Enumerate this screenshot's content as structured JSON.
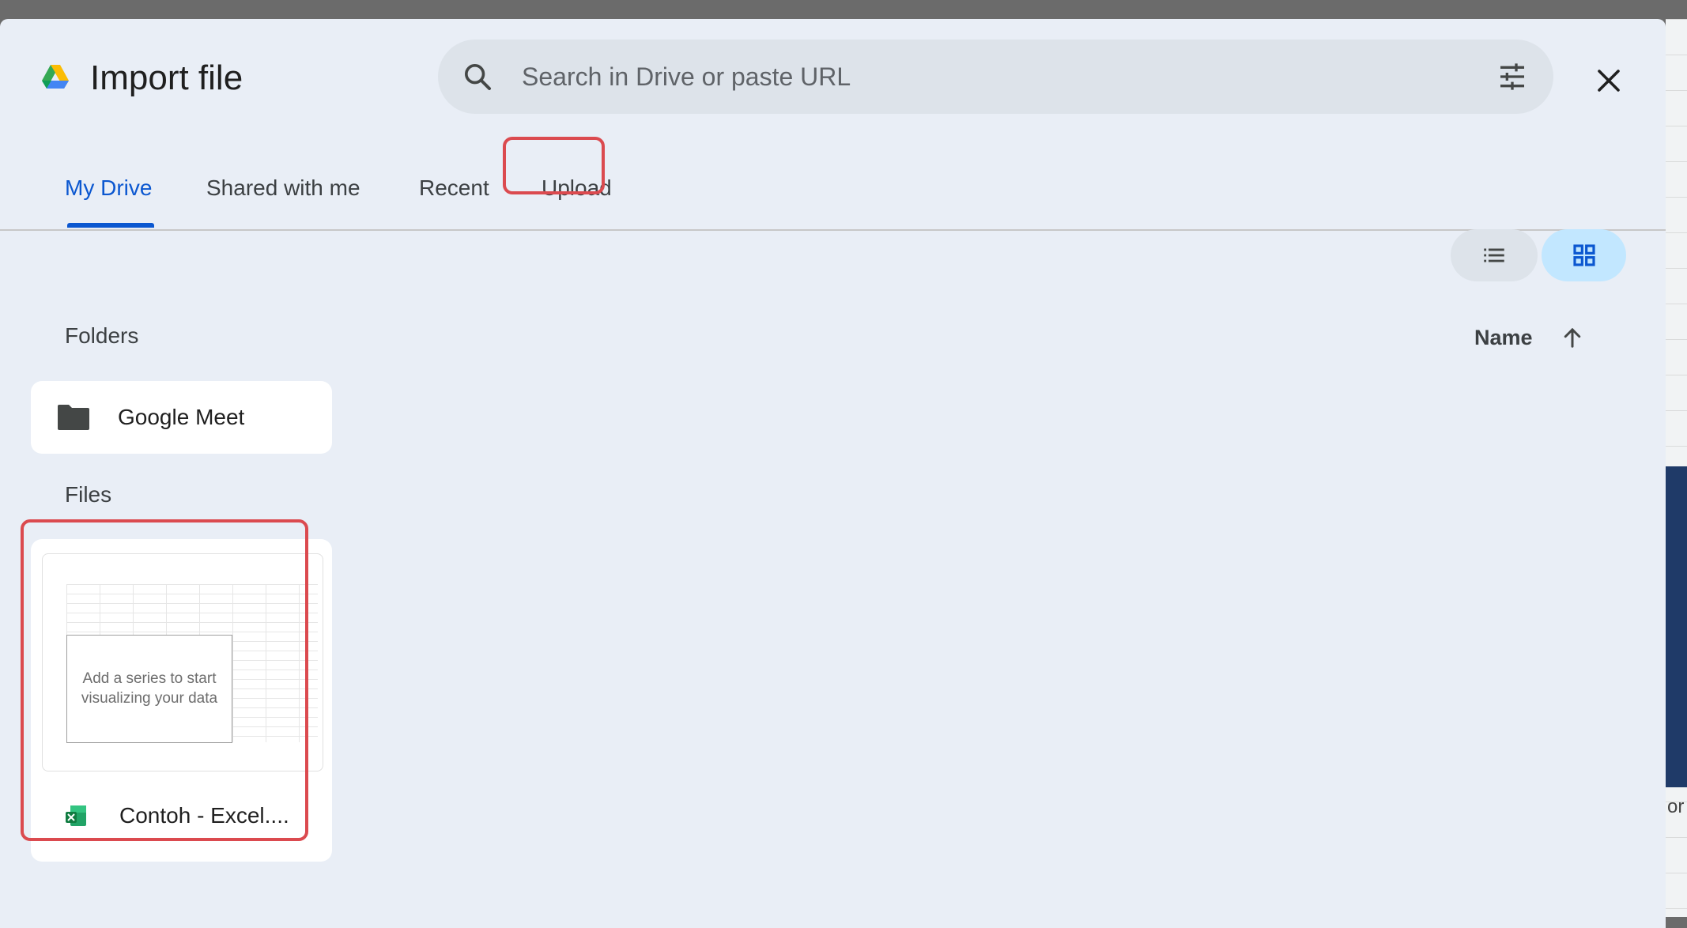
{
  "dialog": {
    "title": "Import file",
    "logo_icon": "google-drive-icon"
  },
  "search": {
    "placeholder": "Search in Drive or paste URL",
    "icon": "search-icon",
    "filter_icon": "tune-filter-icon"
  },
  "close_icon": "close-icon",
  "tabs": [
    {
      "label": "My Drive",
      "active": true
    },
    {
      "label": "Shared with me",
      "active": false
    },
    {
      "label": "Recent",
      "active": false
    },
    {
      "label": "Upload",
      "active": false
    }
  ],
  "view_toggle": {
    "list_icon": "list-view-icon",
    "grid_icon": "grid-view-icon",
    "selected": "grid"
  },
  "sort": {
    "label": "Name",
    "direction_icon": "arrow-up-icon"
  },
  "folders": {
    "heading": "Folders",
    "items": [
      {
        "name": "Google Meet",
        "icon": "folder-icon"
      }
    ]
  },
  "files": {
    "heading": "Files",
    "items": [
      {
        "name": "Contoh - Excel....",
        "icon": "excel-file-icon",
        "thumbnail_text": "Add a series to start visualizing your data"
      }
    ]
  },
  "background": {
    "fragment_text": "or"
  },
  "colors": {
    "accent": "#0b57d0",
    "highlight": "#db4a4f",
    "dialog_bg": "#e9eef6"
  }
}
